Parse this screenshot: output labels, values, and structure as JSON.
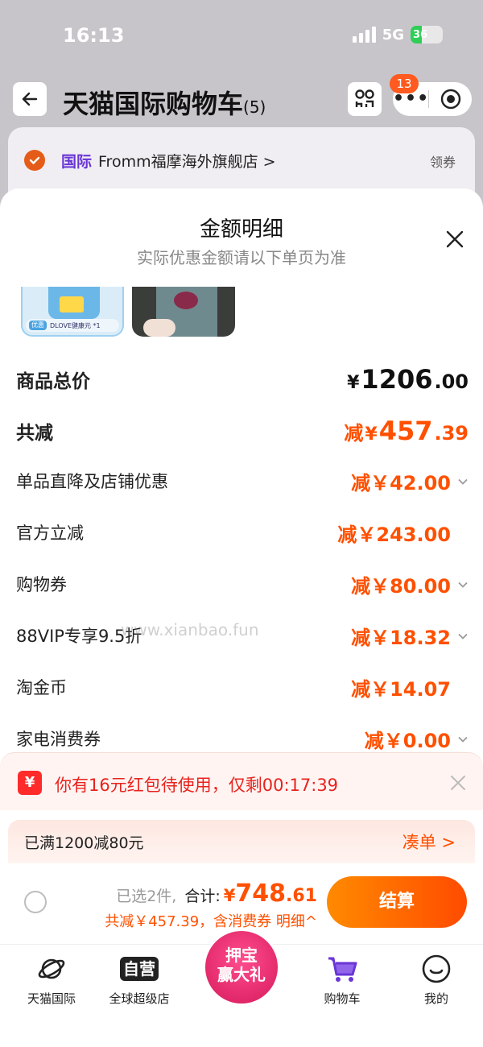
{
  "status_bar": {
    "time": "16:13",
    "network": "5G",
    "battery": "36"
  },
  "header": {
    "title": "天猫国际购物车",
    "count": "(5)",
    "notification_badge": "13"
  },
  "store": {
    "tag": "国际",
    "name": "Fromm福摩海外旗舰店 >",
    "coupon": "领券"
  },
  "sheet": {
    "title": "金额明细",
    "subtitle": "实际优惠金额请以下单页为准",
    "thumb_tag": "优惠",
    "thumb_caption": "DLOVE健康元 *1"
  },
  "breakdown": {
    "total_price": {
      "label": "商品总价",
      "currency": "¥",
      "integer": "1206",
      "decimal": ".00"
    },
    "total_discount": {
      "label": "共减",
      "prefix": "减",
      "currency": "¥",
      "integer": "457",
      "decimal": ".39"
    },
    "items": [
      {
        "label": "单品直降及店铺优惠",
        "amount": "减￥42.00"
      },
      {
        "label": "官方立减",
        "amount": "减￥243.00"
      },
      {
        "label": "购物券",
        "amount": "减￥80.00"
      },
      {
        "label": "88VIP专享9.5折",
        "amount": "减￥18.32"
      },
      {
        "label": "淘金币",
        "amount": "减￥14.07"
      },
      {
        "label": "家电消费券",
        "amount": "减￥0.00"
      }
    ]
  },
  "watermark": "www.xianbao.fun",
  "red_packet": {
    "icon": "¥",
    "text": "你有16元红包待使用，仅剩00:17:39"
  },
  "promo": {
    "text": "已满1200减80元",
    "link": "凑单 >"
  },
  "checkout": {
    "selected": "已选2件,",
    "total_label": "合计:",
    "currency": "¥",
    "total_integer": "748",
    "total_decimal": ".61",
    "saving": "共减￥457.39，含消费券 明细^",
    "button": "结算"
  },
  "tabbar": {
    "items": [
      {
        "label": "天猫国际",
        "icon": "planet-icon"
      },
      {
        "label": "全球超级店",
        "icon": "self-operated-icon",
        "badge_text": "自营"
      },
      {
        "label": "购物车",
        "icon": "cart-icon"
      },
      {
        "label": "我的",
        "icon": "smile-icon"
      }
    ],
    "promo_badge": {
      "line1": "押宝",
      "line2": "赢大礼"
    }
  },
  "colors": {
    "accent": "#ff5000",
    "intl_tag": "#6a35d6",
    "red_packet": "#e8231e",
    "cart_active": "#6a35d6"
  }
}
